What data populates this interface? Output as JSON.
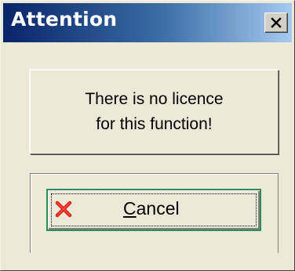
{
  "window": {
    "title": "Attention",
    "close_glyph": "✕",
    "close_icon": "close-icon"
  },
  "message": {
    "lines": [
      "There is no licence",
      "for this function!"
    ]
  },
  "cancel_button": {
    "mnemonic": "C",
    "rest": "ancel",
    "icon": "red-x-icon"
  },
  "colors": {
    "title_gradient_start": "#0a246a",
    "title_gradient_end": "#a6caf0",
    "focus_border": "#2e8b57",
    "cancel_icon": "#e2231a"
  }
}
